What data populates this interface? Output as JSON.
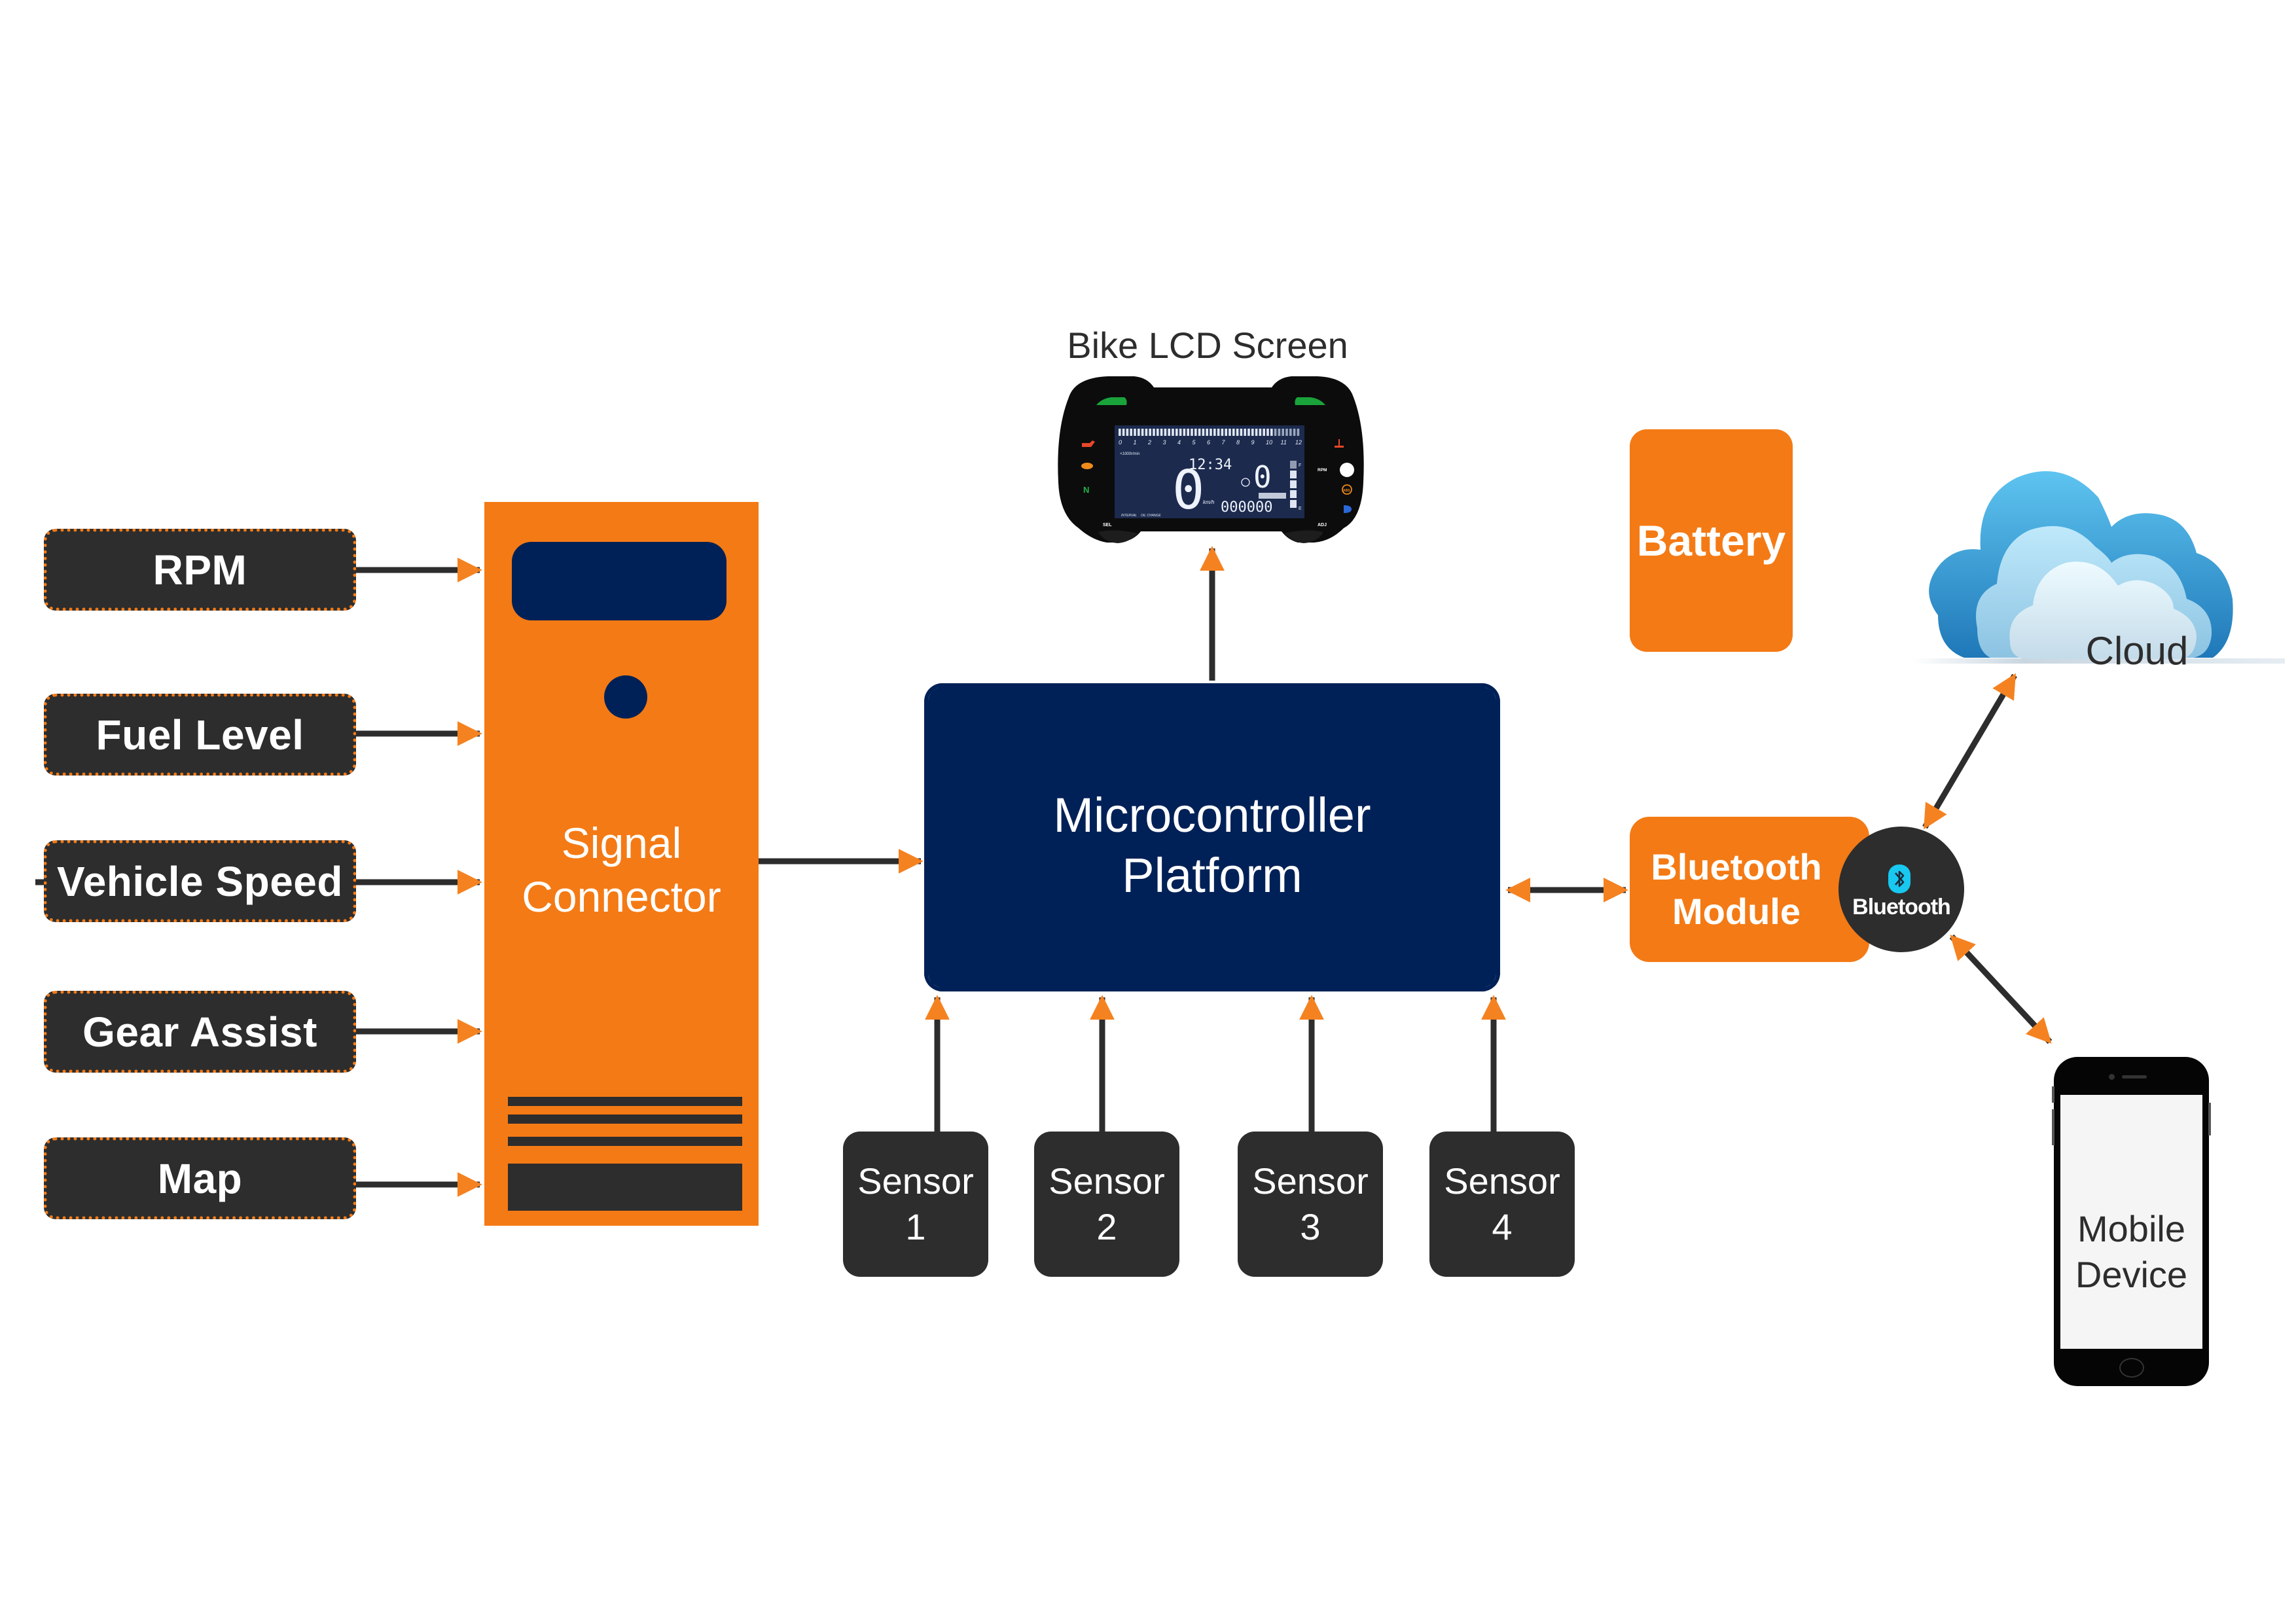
{
  "colors": {
    "orange": "#f47a15",
    "navy": "#002157",
    "dark": "#2d2d2d",
    "arrow_head": "#f58220",
    "bluetooth_cyan": "#18c8f0"
  },
  "inputs": [
    {
      "label": "RPM"
    },
    {
      "label": "Fuel Level"
    },
    {
      "label": "Vehicle Speed"
    },
    {
      "label": "Gear Assist"
    },
    {
      "label": "Map"
    }
  ],
  "signal_connector": {
    "line1": "Signal",
    "line2": "Connector"
  },
  "microcontroller": {
    "line1": "Microcontroller",
    "line2": "Platform"
  },
  "lcd": {
    "title": "Bike LCD Screen",
    "rpm_scale": [
      "0",
      "1",
      "2",
      "3",
      "4",
      "5",
      "6",
      "7",
      "8",
      "9",
      "10",
      "11",
      "12"
    ],
    "rpm_unit": "×1000r/min",
    "clock": "12:34",
    "gear": "0",
    "gear_label": "GEAR",
    "speed": "0",
    "speed_unit": "km/h",
    "odometer": "000000",
    "fuel_full": "F",
    "fuel_empty": "E",
    "interval_label": "INTERVAL",
    "oil_change_label": "OIL CHANGE",
    "sel_label": "SEL",
    "adj_label": "ADJ",
    "rpm_label": "RPM",
    "neutral_label": "N",
    "abs_label": "ABS"
  },
  "sensors": [
    {
      "line1": "Sensor",
      "line2": "1"
    },
    {
      "line1": "Sensor",
      "line2": "2"
    },
    {
      "line1": "Sensor",
      "line2": "3"
    },
    {
      "line1": "Sensor",
      "line2": "4"
    }
  ],
  "battery": {
    "label": "Battery"
  },
  "bluetooth_module": {
    "line1": "Bluetooth",
    "line2": "Module"
  },
  "bluetooth_badge": {
    "label": "Bluetooth",
    "icon": "bluetooth-icon"
  },
  "cloud": {
    "label": "Cloud",
    "icon": "cloud-icon"
  },
  "mobile": {
    "line1": "Mobile",
    "line2": "Device",
    "icon": "smartphone-icon"
  }
}
